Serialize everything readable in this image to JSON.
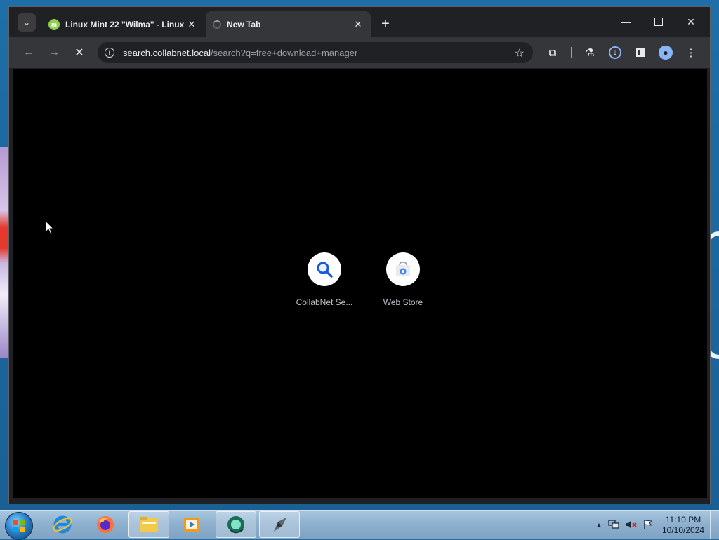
{
  "browser": {
    "tabs": [
      {
        "title": "Linux Mint 22 \"Wilma\" - Linux",
        "active": false
      },
      {
        "title": "New Tab",
        "active": true
      }
    ],
    "address_bar": {
      "url_host": "search.collabnet.local",
      "url_path": "/search?q=free+download+manager"
    },
    "shortcuts": [
      {
        "label": "CollabNet Se...",
        "icon": "search-icon"
      },
      {
        "label": "Web Store",
        "icon": "web-store-icon"
      }
    ],
    "colors": {
      "frame": "#202124",
      "toolbar": "#35363a",
      "content": "#000000",
      "text": "#e8eaed"
    }
  },
  "taskbar": {
    "apps": [
      "internet-explorer-icon",
      "firefox-icon",
      "file-explorer-icon",
      "media-player-icon",
      "browser-icon",
      "app-icon"
    ],
    "clock": {
      "time": "11:10 PM",
      "date": "10/10/2024"
    }
  }
}
